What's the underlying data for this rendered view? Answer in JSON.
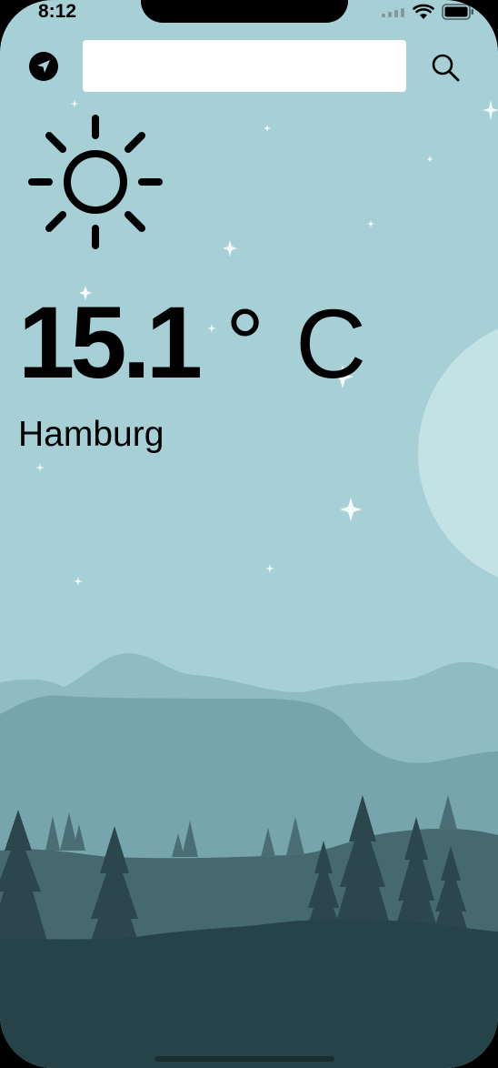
{
  "status_bar": {
    "time": "8:12"
  },
  "top_bar": {
    "search_placeholder": "",
    "search_value": "",
    "locate_icon": "location-arrow-icon",
    "search_icon": "magnifier-icon"
  },
  "weather": {
    "condition_icon": "sun-icon",
    "temperature": "15.1",
    "unit": "° C",
    "city": "Hamburg"
  },
  "colors": {
    "sky": "#a6d0d6",
    "moon": "#c3e2e6",
    "far_hills": "#8fbcc2",
    "mid_hills": "#76a6ac",
    "near_hills": "#46696f",
    "trees": "#2b474d",
    "ground": "#26434a"
  }
}
